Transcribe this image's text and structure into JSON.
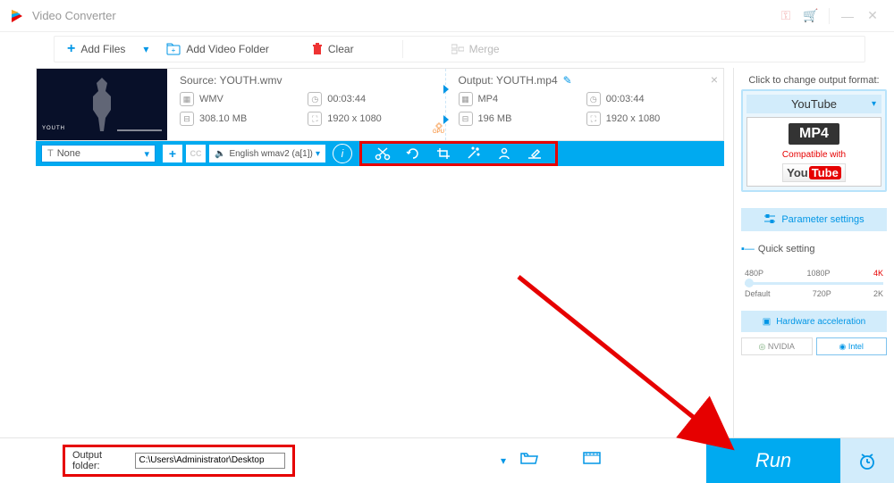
{
  "app": {
    "title": "Video Converter"
  },
  "toolbar": {
    "addFiles": "Add Files",
    "addFolder": "Add Video Folder",
    "clear": "Clear",
    "merge": "Merge"
  },
  "file": {
    "thumbTag": "YOUTH",
    "source": {
      "label": "Source: YOUTH.wmv",
      "format": "WMV",
      "duration": "00:03:44",
      "size": "308.10 MB",
      "resolution": "1920 x 1080"
    },
    "output": {
      "label": "Output: YOUTH.mp4",
      "format": "MP4",
      "duration": "00:03:44",
      "size": "196 MB",
      "resolution": "1920 x 1080"
    },
    "gpuLabel": "GPU"
  },
  "controls": {
    "dropdown": "None",
    "audio": "English wmav2 (a[1])"
  },
  "rightPanel": {
    "clickLabel": "Click to change output format:",
    "profileName": "YouTube",
    "badge": "MP4",
    "compat": "Compatible with",
    "ytYou": "You",
    "ytTube": "Tube",
    "paramBtn": "Parameter settings",
    "quickLabel": "Quick setting",
    "ticksTop": [
      "480P",
      "1080P",
      "4K"
    ],
    "ticksBot": [
      "Default",
      "720P",
      "2K"
    ],
    "hwLabel": "Hardware acceleration",
    "nvidia": "NVIDIA",
    "intel": "Intel"
  },
  "bottom": {
    "outLabel": "Output folder:",
    "outPath": "C:\\Users\\Administrator\\Desktop",
    "run": "Run"
  }
}
